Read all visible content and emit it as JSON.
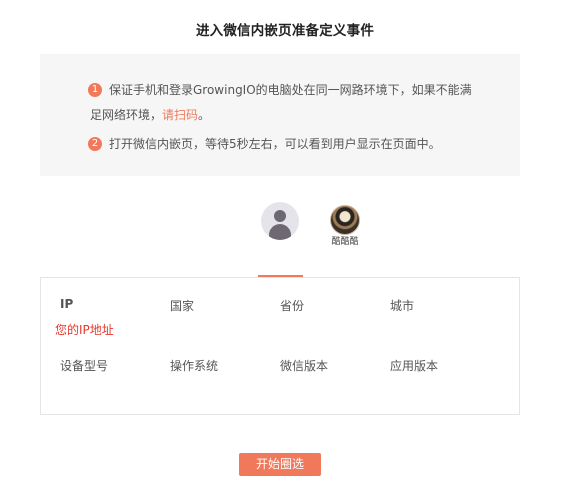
{
  "title": "进入微信内嵌页准备定义事件",
  "instructions": {
    "step1": {
      "number": "1",
      "line1": "保证手机和登录GrowingIO的电脑处在同一网路环境下，如果不能满",
      "line2_prefix": "足网络环境，",
      "link": "请扫码",
      "line2_suffix": "。"
    },
    "step2": {
      "number": "2",
      "text": "打开微信内嵌页，等待5秒左右，可以看到用户显示在页面中。"
    }
  },
  "users": [
    {
      "name": "",
      "avatar": "default-user-icon"
    },
    {
      "name": "酷酷酷",
      "avatar": "user-photo"
    }
  ],
  "info": {
    "labels": {
      "ip": "IP",
      "country": "国家",
      "province": "省份",
      "city": "城市",
      "device_model": "设备型号",
      "os": "操作系统",
      "wechat_version": "微信版本",
      "app_version": "应用版本"
    },
    "ip_value": "您的IP地址"
  },
  "start_button": "开始圈选",
  "colors": {
    "accent": "#f0795c",
    "ip_value": "#e5372d",
    "panel_bg": "#f6f6f6"
  }
}
